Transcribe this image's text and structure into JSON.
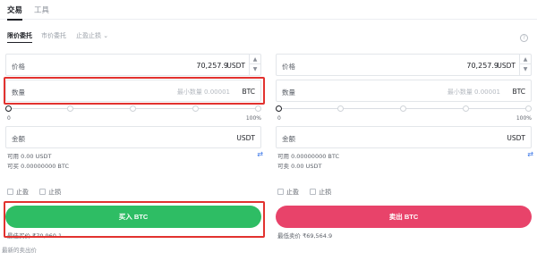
{
  "top_tabs": [
    "交易",
    "工具"
  ],
  "order_tabs": [
    "限价委托",
    "市价委托",
    "止盈止损"
  ],
  "order_tab_dropdown": "⌄",
  "info_icon": "?",
  "buy": {
    "price_label": "价格",
    "price_value": "70,257.9",
    "price_unit": "USDT",
    "amount_label": "数量",
    "amount_placeholder": "最小数量 0.00001",
    "amount_unit": "BTC",
    "slider_min": "0",
    "slider_max": "100%",
    "total_label": "金额",
    "total_unit": "USDT",
    "available": "可用 0.00 USDT",
    "can_buy": "可买 0.00000000 BTC",
    "tp_label": "止盈",
    "sl_label": "止损",
    "button_label": "买入 BTC",
    "best_price": "最佳买价 ₹70,960.1"
  },
  "sell": {
    "price_label": "价格",
    "price_value": "70,257.9",
    "price_unit": "USDT",
    "amount_label": "数量",
    "amount_placeholder": "最小数量 0.00001",
    "amount_unit": "BTC",
    "slider_min": "0",
    "slider_max": "100%",
    "total_label": "金额",
    "total_unit": "USDT",
    "available": "可用 0.00000000 BTC",
    "can_sell": "可卖 0.00 USDT",
    "tp_label": "止盈",
    "sl_label": "止损",
    "button_label": "卖出 BTC",
    "best_price": "最低卖价 ₹69,564.9"
  },
  "footnote": "最新的卖出价",
  "colors": {
    "buy": "#2ebd64",
    "sell": "#e8436a",
    "highlight": "#e2322f",
    "link": "#3a76e8"
  },
  "icons": {
    "swap": "⇄",
    "up": "▲",
    "down": "▼"
  }
}
